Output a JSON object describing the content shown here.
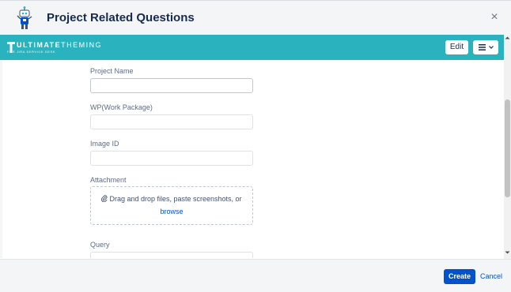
{
  "dialog": {
    "title": "Project Related Questions",
    "close_symbol": "×"
  },
  "icons": {
    "app_logo": "robot-icon",
    "close": "close-icon",
    "menu": "hamburger-menu-icon",
    "dropdown": "chevron-down-icon",
    "attachment": "paperclip-icon"
  },
  "banner": {
    "logo_text_bold": "ULTIMATE",
    "logo_text_light": "THEMING",
    "logo_subtext": "FOR JIRA SERVICE DESK",
    "edit_label": "Edit",
    "background_color": "#2ab3bf"
  },
  "form": {
    "fields": [
      {
        "label": "Project Name",
        "value": ""
      },
      {
        "label": "WP(Work Package)",
        "value": ""
      },
      {
        "label": "Image ID",
        "value": ""
      },
      {
        "label": "Query",
        "value": ""
      }
    ],
    "attachment": {
      "label": "Attachment",
      "drop_text": "Drag and drop files, paste screenshots, or",
      "browse_link": "browse"
    }
  },
  "footer": {
    "create_label": "Create",
    "cancel_label": "Cancel",
    "primary_color": "#0052cc"
  }
}
